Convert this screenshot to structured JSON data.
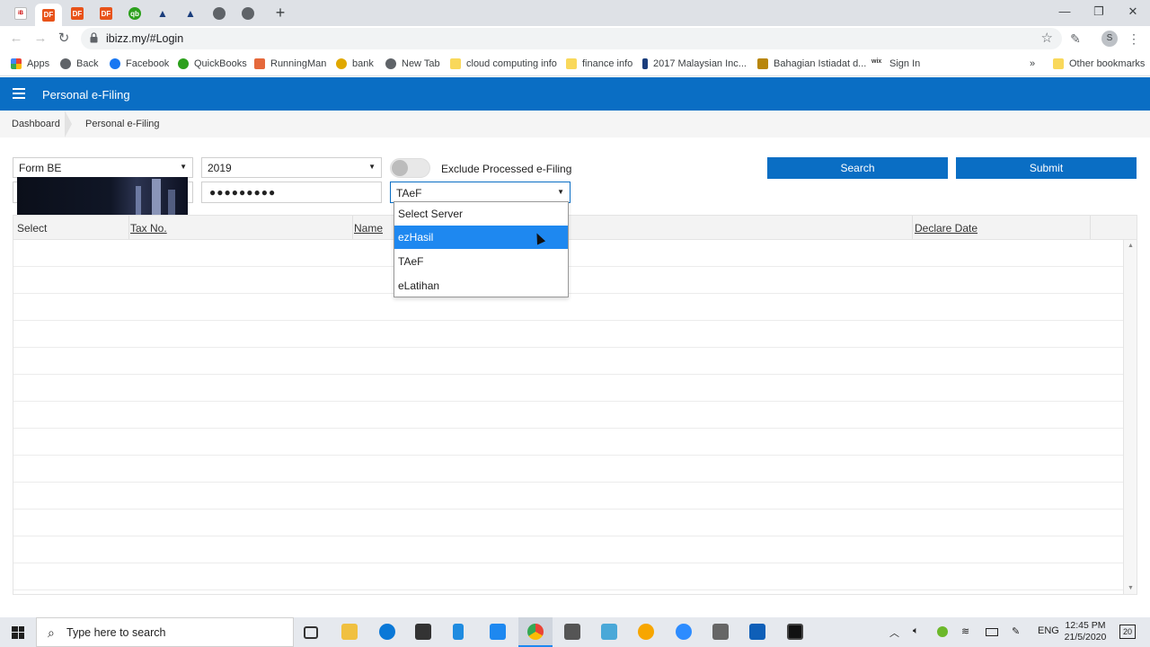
{
  "browser": {
    "url": "ibizz.my/#Login",
    "profile_initial": "S",
    "bookmarks": [
      {
        "label": "Apps",
        "color": "#ea4335"
      },
      {
        "label": "Back",
        "color": "#5f6368"
      },
      {
        "label": "Facebook",
        "color": "#1877f2"
      },
      {
        "label": "QuickBooks",
        "color": "#2ca01c"
      },
      {
        "label": "RunningMan",
        "color": "#e5683b"
      },
      {
        "label": "bank",
        "color": "#e0a800"
      },
      {
        "label": "New Tab",
        "color": "#5f6368"
      },
      {
        "label": "cloud computing info",
        "color": "#f9d85b"
      },
      {
        "label": "finance info",
        "color": "#f9d85b"
      },
      {
        "label": "2017 Malaysian Inc...",
        "color": "#1a3d7c"
      },
      {
        "label": "Bahagian Istiadat d...",
        "color": "#b8860b"
      },
      {
        "label": "Sign In",
        "color": "#333333"
      }
    ],
    "bookmarks_more": "»",
    "other_bookmarks": "Other bookmarks"
  },
  "app": {
    "title": "Personal e-Filing",
    "breadcrumb": [
      "Dashboard",
      "Personal e-Filing"
    ]
  },
  "form": {
    "form_type": "Form BE",
    "year": "2019",
    "exclude_label": "Exclude Processed e-Filing",
    "exclude_on": false,
    "password_mask": "●●●●●●●●●",
    "server_value": "TAeF",
    "search_label": "Search",
    "submit_label": "Submit"
  },
  "grid": {
    "columns": [
      "Select",
      "Tax No.",
      "Name",
      "Declare Date"
    ]
  },
  "dropdown": {
    "options": [
      "Select Server",
      "ezHasil",
      "TAeF",
      "eLatihan"
    ],
    "highlighted": "ezHasil"
  },
  "taskbar": {
    "search_placeholder": "Type here to search",
    "language": "ENG",
    "time": "12:45 PM",
    "date": "21/5/2020",
    "notifications": "20"
  },
  "colors": {
    "brand": "#0a6ec4",
    "highlight": "#1e88f0"
  }
}
